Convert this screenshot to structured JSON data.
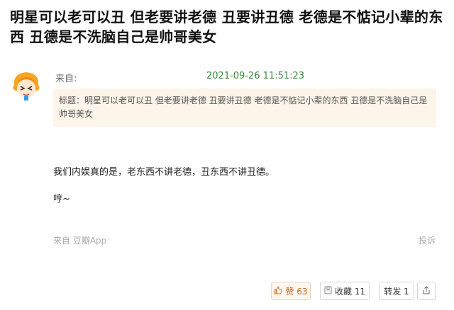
{
  "post": {
    "title": "明星可以老可以丑 但老要讲老德 丑要讲丑德 老德是不惦记小辈的东西 丑德是不洗脑自己是帅哥美女",
    "from_label": "来自:",
    "timestamp": "2021-09-26 11:51:23",
    "quote": "标题：明星可以老可以丑 但老要讲老德 丑要讲丑德 老德是不惦记小辈的东西 丑德是不洗脑自己是帅哥美女",
    "body_line1": "我们内娱真的是，老东西不讲老德，丑东西不讲丑德。",
    "body_line2": "哼~",
    "source": "来自 豆瓣App",
    "report": "投诉"
  },
  "actions": {
    "like_label": "赞 63",
    "fav_label": "收藏 11",
    "share_label": "转发 1"
  },
  "icons": {
    "like": "thumbs-up-icon",
    "fav": "bookmark-icon",
    "ext": "share-out-icon"
  },
  "colors": {
    "timestamp": "#3a8b3a",
    "quote_bg": "#fdf4ea",
    "like_accent": "#d9782f"
  }
}
